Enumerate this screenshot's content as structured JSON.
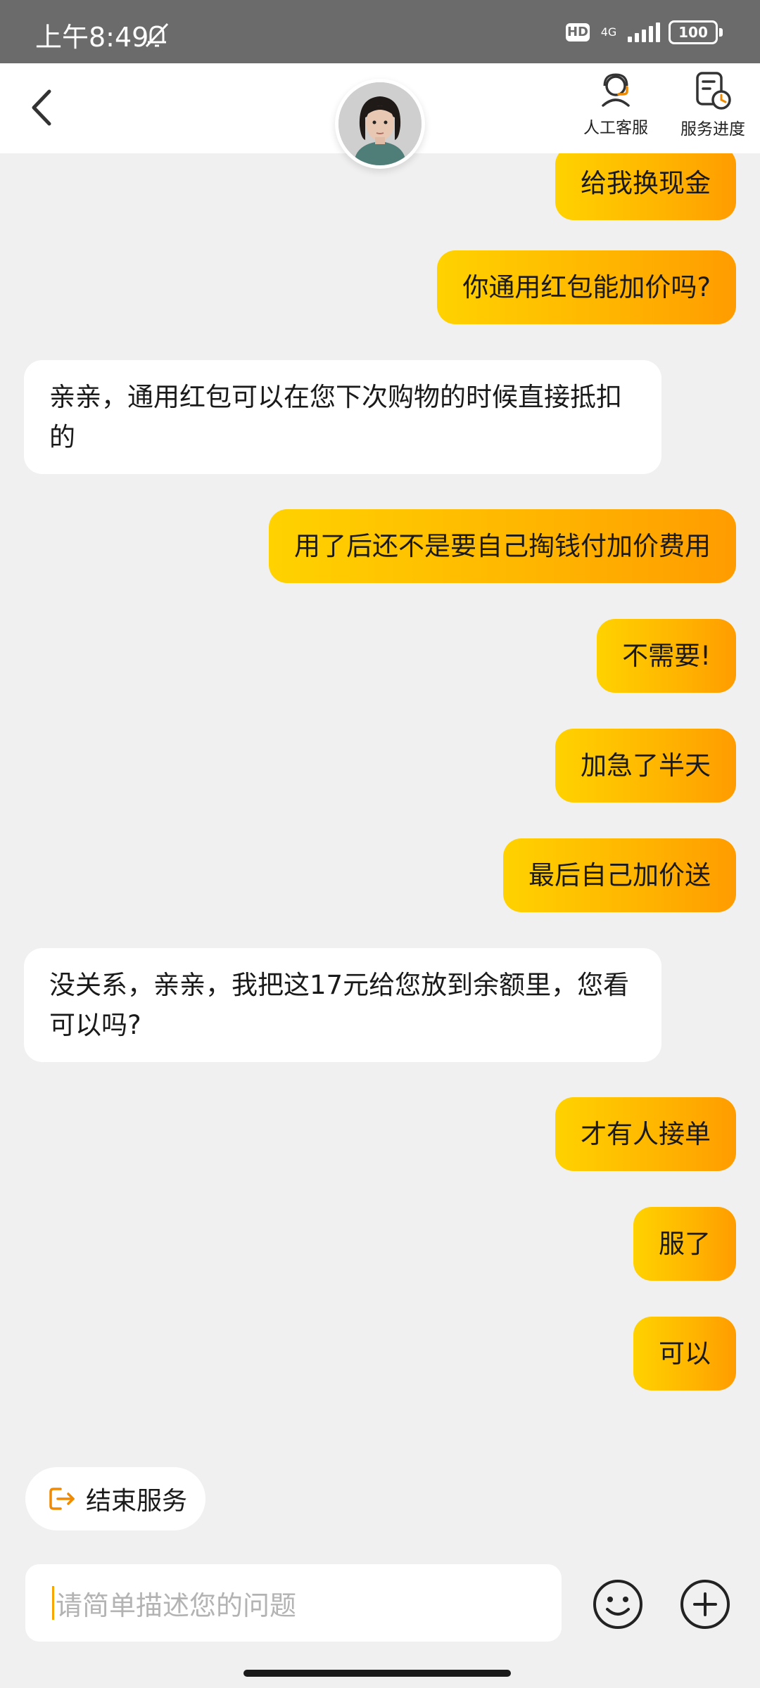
{
  "status_bar": {
    "time": "上午8:49",
    "hd": "HD",
    "network": "4G",
    "battery": "100"
  },
  "header": {
    "human_service_label": "人工客服",
    "service_progress_label": "服务进度"
  },
  "messages": [
    {
      "from": "me",
      "text": "给我换现金"
    },
    {
      "from": "me",
      "text": "你通用红包能加价吗?"
    },
    {
      "from": "agent",
      "text": "亲亲，通用红包可以在您下次购物的时候直接抵扣的"
    },
    {
      "from": "me",
      "text": "用了后还不是要自己掏钱付加价费用"
    },
    {
      "from": "me",
      "text": "不需要!"
    },
    {
      "from": "me",
      "text": "加急了半天"
    },
    {
      "from": "me",
      "text": "最后自己加价送"
    },
    {
      "from": "agent",
      "text": "没关系，亲亲，我把这17元给您放到余额里，您看可以吗?"
    },
    {
      "from": "me",
      "text": "才有人接单"
    },
    {
      "from": "me",
      "text": "服了"
    },
    {
      "from": "me",
      "text": "可以"
    }
  ],
  "bottom": {
    "end_service_label": "结束服务",
    "input_placeholder": "请简单描述您的问题"
  },
  "colors": {
    "accent": "#ffb400",
    "bubble_me_start": "#ffd200",
    "bubble_me_end": "#ff9c00",
    "icon_orange": "#f08a00"
  }
}
